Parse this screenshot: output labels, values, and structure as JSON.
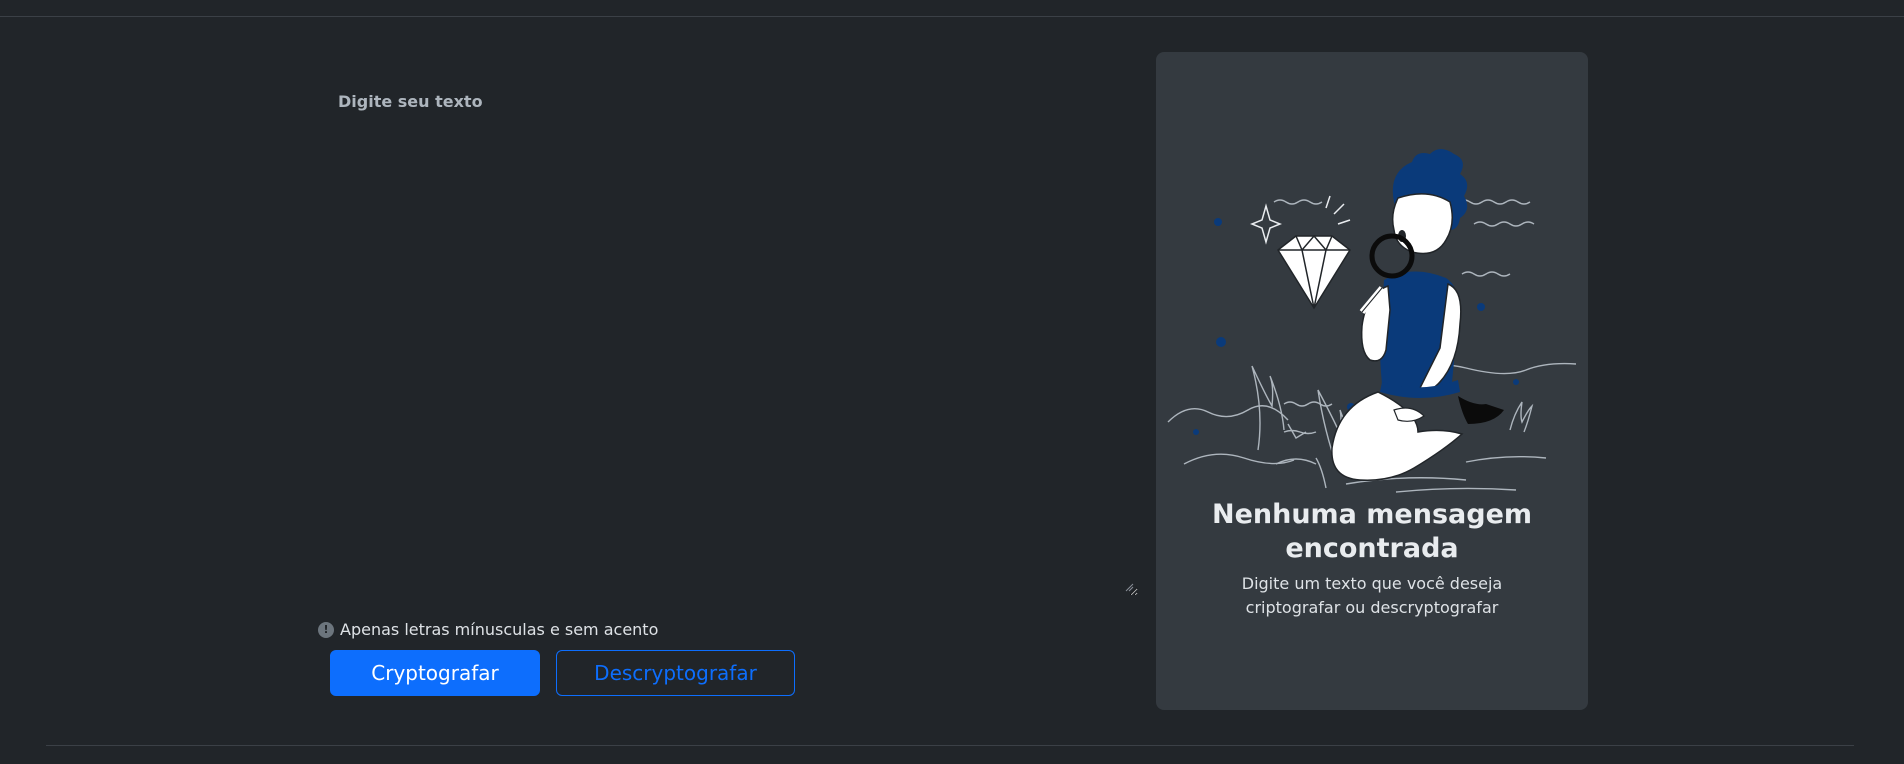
{
  "input": {
    "label": "Digite seu texto",
    "value": "",
    "placeholder": ""
  },
  "hint": {
    "icon": "info-icon",
    "icon_glyph": "!",
    "text": "Apenas letras mínusculas e sem acento"
  },
  "actions": {
    "encrypt_label": "Cryptografar",
    "decrypt_label": "Descryptografar"
  },
  "result": {
    "illustration": "person-with-magnifier-and-diamond-illustration",
    "title": "Nenhuma mensagem encontrada",
    "description": "Digite um texto que você deseja criptografar ou descryptografar"
  },
  "colors": {
    "background": "#212529",
    "card": "#343a40",
    "accent": "#0d6efd",
    "illustration_blue": "#0a3a7a"
  }
}
